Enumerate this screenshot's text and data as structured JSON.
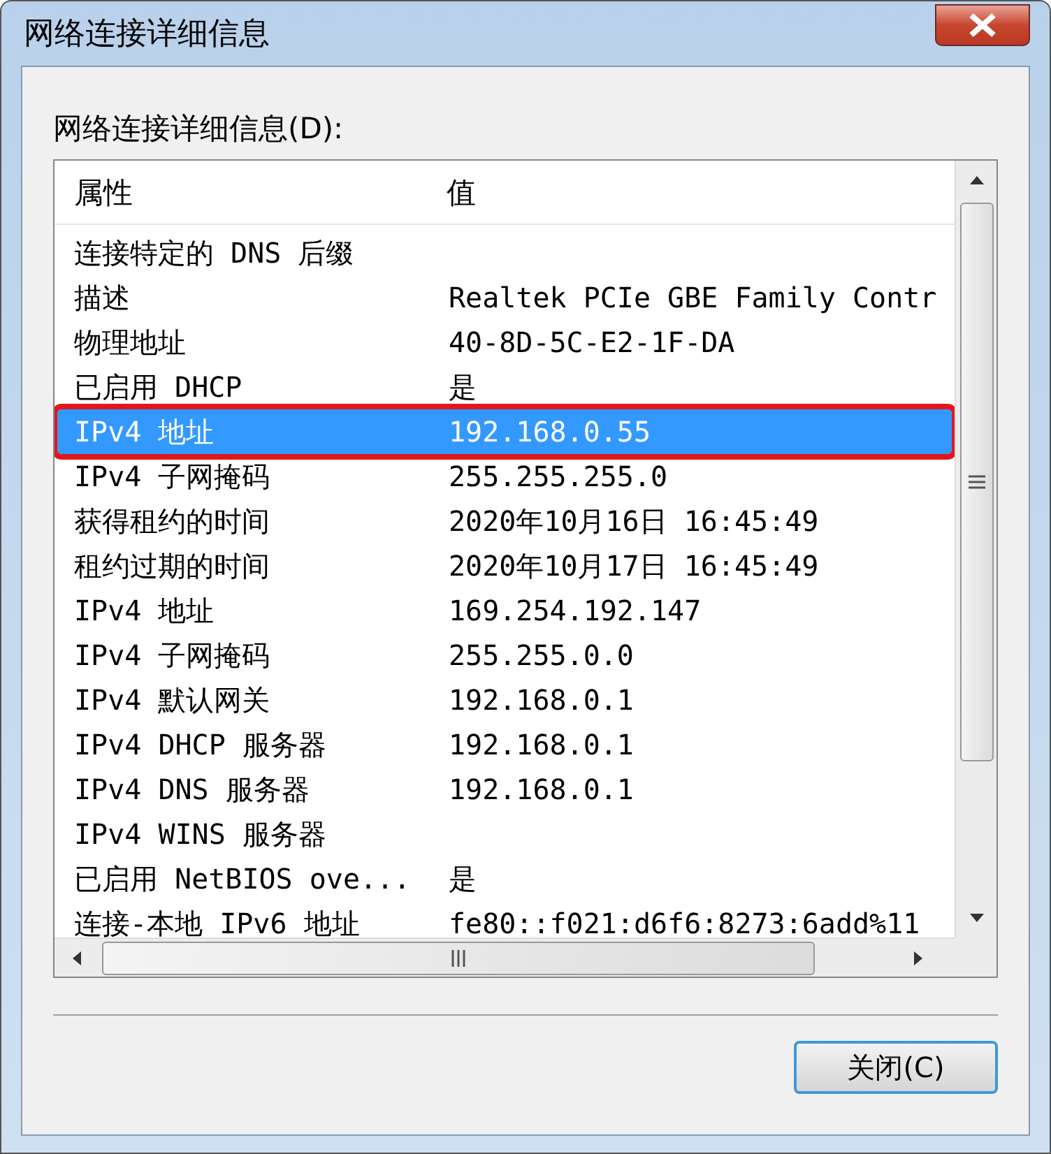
{
  "window": {
    "title": "网络连接详细信息"
  },
  "group_label": "网络连接详细信息(D):",
  "table": {
    "columns": [
      "属性",
      "值"
    ],
    "rows": [
      {
        "property": "连接特定的 DNS 后缀",
        "value": "",
        "selected": false,
        "annotated": false
      },
      {
        "property": "描述",
        "value": "Realtek PCIe GBE Family Contr",
        "selected": false,
        "annotated": false
      },
      {
        "property": "物理地址",
        "value": "40-8D-5C-E2-1F-DA",
        "selected": false,
        "annotated": false
      },
      {
        "property": "已启用 DHCP",
        "value": "是",
        "selected": false,
        "annotated": false
      },
      {
        "property": "IPv4 地址",
        "value": "192.168.0.55",
        "selected": true,
        "annotated": true
      },
      {
        "property": "IPv4 子网掩码",
        "value": "255.255.255.0",
        "selected": false,
        "annotated": false
      },
      {
        "property": "获得租约的时间",
        "value": "2020年10月16日 16:45:49",
        "selected": false,
        "annotated": false
      },
      {
        "property": "租约过期的时间",
        "value": "2020年10月17日 16:45:49",
        "selected": false,
        "annotated": false
      },
      {
        "property": "IPv4 地址",
        "value": "169.254.192.147",
        "selected": false,
        "annotated": false
      },
      {
        "property": "IPv4 子网掩码",
        "value": "255.255.0.0",
        "selected": false,
        "annotated": false
      },
      {
        "property": "IPv4 默认网关",
        "value": "192.168.0.1",
        "selected": false,
        "annotated": false
      },
      {
        "property": "IPv4 DHCP 服务器",
        "value": "192.168.0.1",
        "selected": false,
        "annotated": false
      },
      {
        "property": "IPv4 DNS 服务器",
        "value": "192.168.0.1",
        "selected": false,
        "annotated": false
      },
      {
        "property": "IPv4 WINS 服务器",
        "value": "",
        "selected": false,
        "annotated": false
      },
      {
        "property": "已启用 NetBIOS ove...",
        "value": "是",
        "selected": false,
        "annotated": false
      },
      {
        "property": "连接-本地 IPv6 地址",
        "value": "fe80::f021:d6f6:8273:6add%11",
        "selected": false,
        "annotated": false
      }
    ]
  },
  "buttons": [
    "关闭(C)"
  ]
}
